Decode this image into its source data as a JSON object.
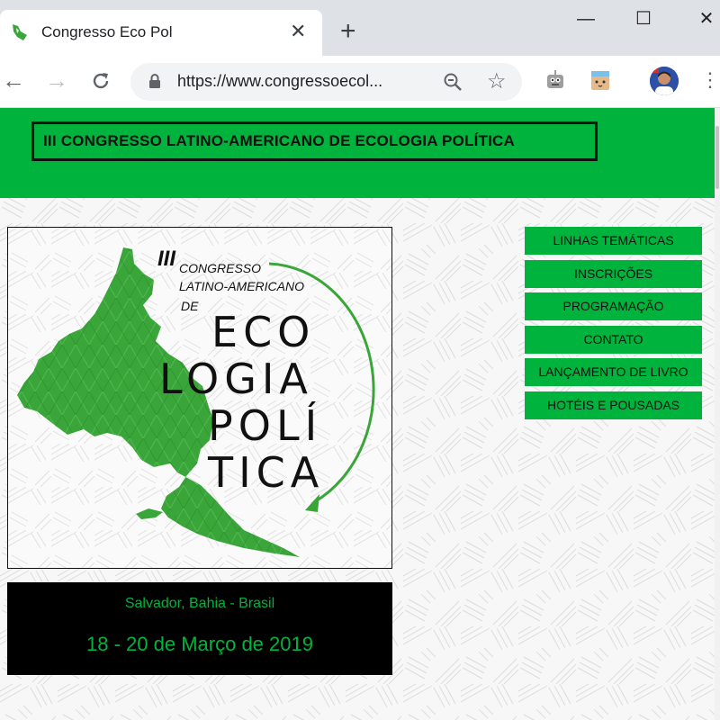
{
  "browser": {
    "tab_title": "Congresso Eco Pol",
    "tab_close": "✕",
    "new_tab": "+",
    "url": "https://www.congressoecol...",
    "window_controls": {
      "minimize": "—",
      "maximize": "☐",
      "close": "✕"
    }
  },
  "page": {
    "title": "III CONGRESSO LATINO-AMERICANO DE ECOLOGIA POLÍTICA",
    "poster": {
      "roman": "III",
      "line1": "CONGRESSO",
      "line2": "LATINO-AMERICANO",
      "line3": "DE",
      "word_rows": [
        "ECO",
        "LOGIA",
        "POLÍ",
        "TICA"
      ]
    },
    "location": "Salvador, Bahia - Brasil",
    "dates": "18 - 20 de Março de 2019",
    "menu": [
      "LINHAS TEMÁTICAS",
      "INSCRIÇÕES",
      "PROGRAMAÇÃO",
      "CONTATO",
      "LANÇAMENTO DE LIVRO",
      "HOTÉIS E POUSADAS"
    ]
  },
  "colors": {
    "accent_green": "#00b33c",
    "map_green": "#3aa63a",
    "black": "#000000"
  }
}
